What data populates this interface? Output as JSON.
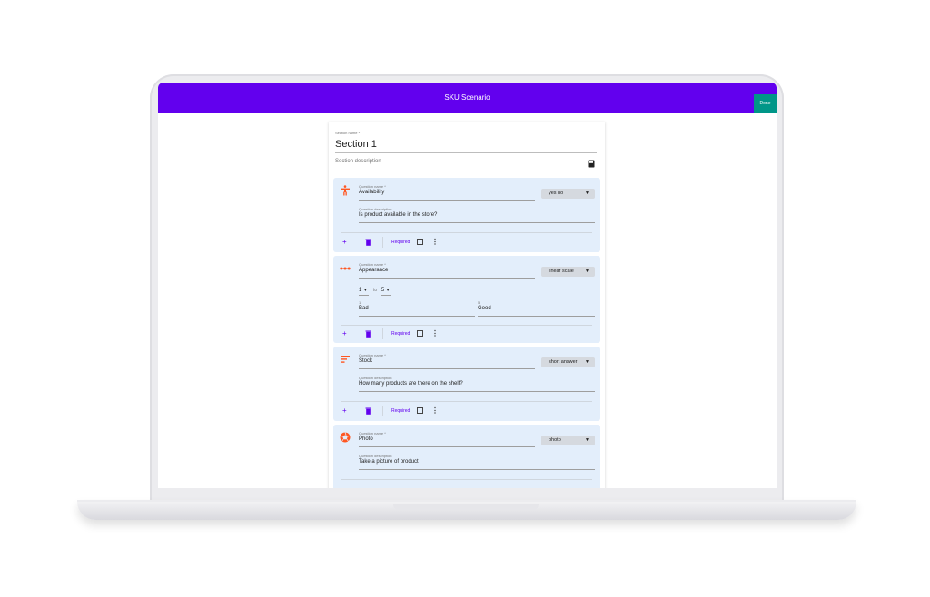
{
  "app": {
    "title": "SKU Scenario",
    "done_label": "Done"
  },
  "colors": {
    "primary": "#6200ee",
    "accent": "#009688",
    "icon": "#ff5722",
    "card_bg": "#e3eefb"
  },
  "section": {
    "name_label": "Section name *",
    "name": "Section 1",
    "description_placeholder": "Section description"
  },
  "common": {
    "question_label": "Question name *",
    "description_label": "Question description",
    "required_label": "Required",
    "add": "+",
    "more": "⋮",
    "select_arrow": "▼"
  },
  "questions": [
    {
      "icon": "accessibility-icon",
      "name": "Availability",
      "type": "yes no",
      "description": "Is product available in the store?"
    },
    {
      "icon": "linear-scale-icon",
      "name": "Appearance",
      "type": "linear scale",
      "scale": {
        "min": "1",
        "to": "to",
        "max": "5",
        "min_caption": "1",
        "min_label": "Bad",
        "max_caption": "5",
        "max_label": "Good"
      }
    },
    {
      "icon": "short-text-icon",
      "name": "Stock",
      "type": "short answer",
      "description": "How many products are there on the shelf?"
    },
    {
      "icon": "camera-icon",
      "name": "Photo",
      "type": "photo",
      "description": "Take a picture of product"
    }
  ]
}
